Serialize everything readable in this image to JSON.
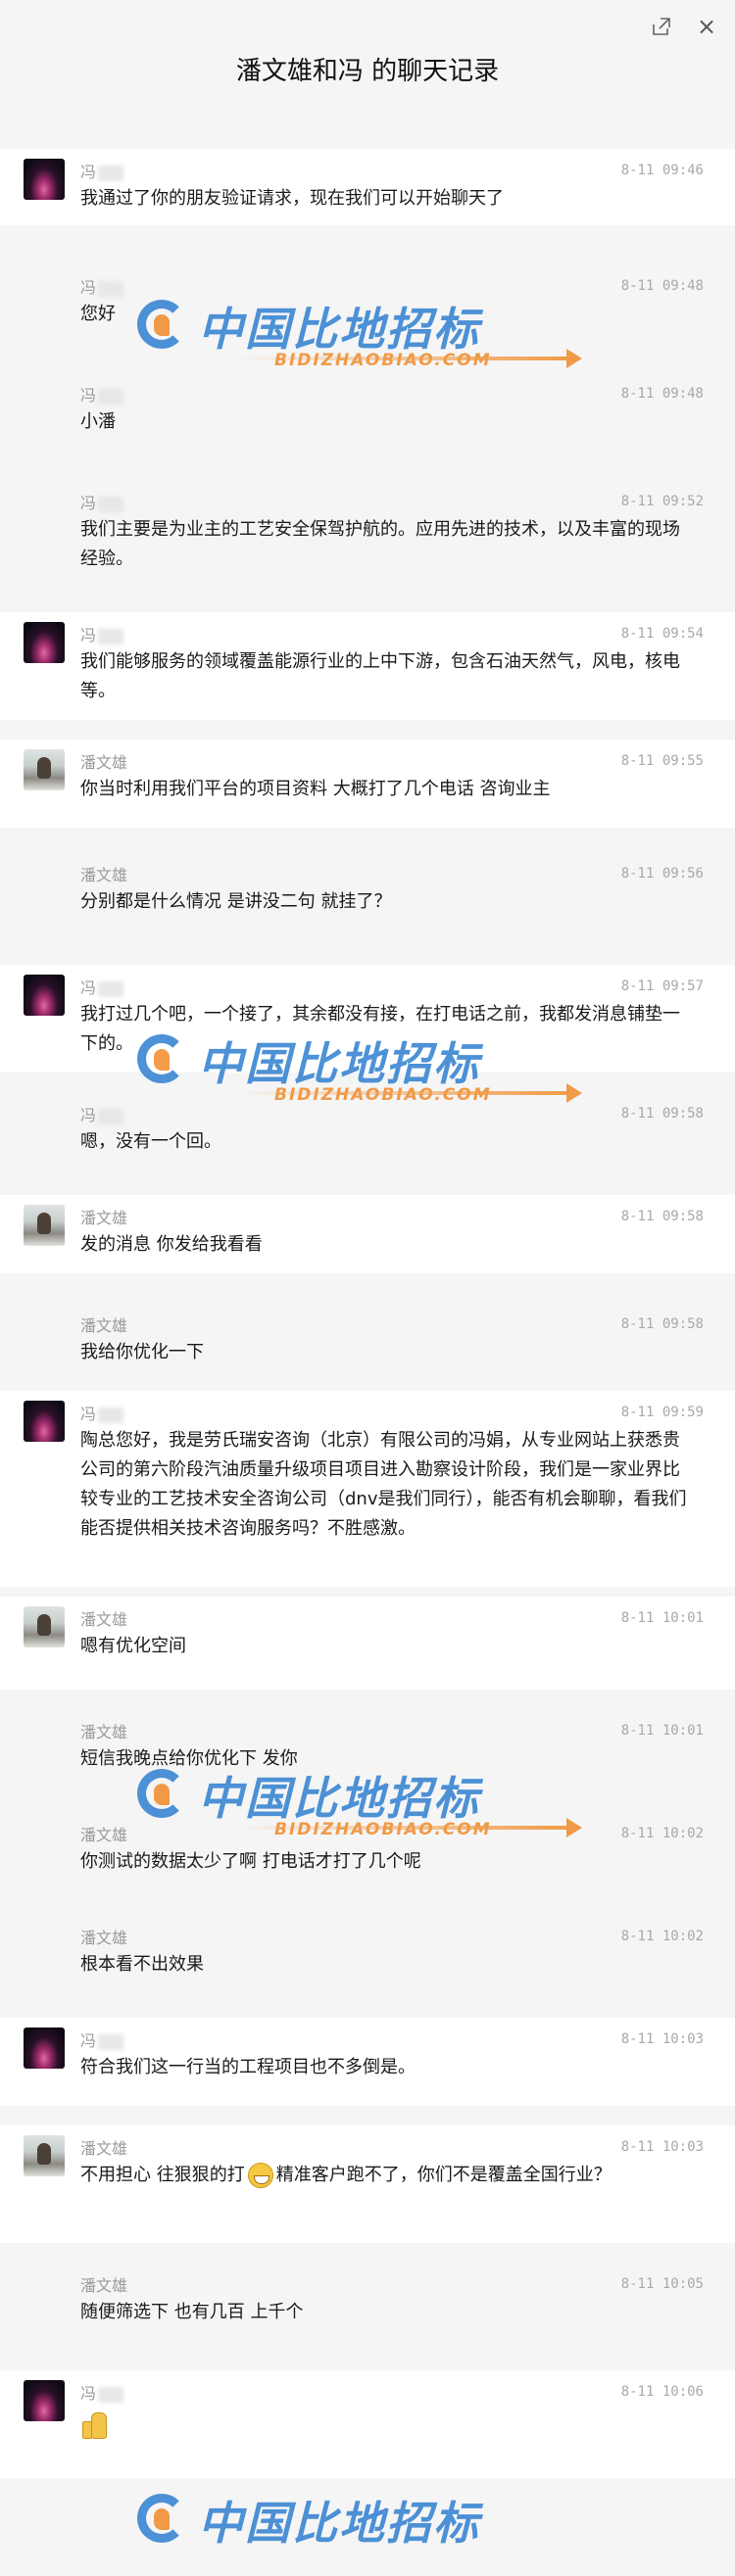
{
  "window": {
    "title": "潘文雄和冯 的聊天记录",
    "popout_icon": "popout-icon",
    "close_icon": "close-icon",
    "close_glyph": "×"
  },
  "watermark": {
    "cn": "中国比地招标",
    "en": "BIDIZHAOBIAO.COM",
    "colors": {
      "blue": "#2f7fd0",
      "orange": "#f08b2a"
    }
  },
  "messages": [
    {
      "sender": "冯",
      "time": "8-11 09:46",
      "text": "我通过了你的朋友验证请求，现在我们可以开始聊天了"
    },
    {
      "sender": "冯",
      "time": "8-11 09:48",
      "text": "您好"
    },
    {
      "sender": "冯",
      "time": "8-11 09:48",
      "text": "小潘"
    },
    {
      "sender": "冯",
      "time": "8-11 09:52",
      "text": "我们主要是为业主的工艺安全保驾护航的。应用先进的技术，以及丰富的现场经验。"
    },
    {
      "sender": "冯",
      "time": "8-11 09:54",
      "text": "我们能够服务的领域覆盖能源行业的上中下游，包含石油天然气，风电，核电等。"
    },
    {
      "sender": "潘文雄",
      "time": "8-11 09:55",
      "text": "你当时利用我们平台的项目资料 大概打了几个电话 咨询业主"
    },
    {
      "sender": "潘文雄",
      "time": "8-11 09:56",
      "text": "分别都是什么情况 是讲没二句 就挂了？"
    },
    {
      "sender": "冯",
      "time": "8-11 09:57",
      "text": "我打过几个吧，一个接了，其余都没有接，在打电话之前，我都发消息铺垫一下的。"
    },
    {
      "sender": "冯",
      "time": "8-11 09:58",
      "text": "嗯，没有一个回。"
    },
    {
      "sender": "潘文雄",
      "time": "8-11 09:58",
      "text": "发的消息 你发给我看看"
    },
    {
      "sender": "潘文雄",
      "time": "8-11 09:58",
      "text": "我给你优化一下"
    },
    {
      "sender": "冯",
      "time": "8-11 09:59",
      "text": "陶总您好，我是劳氏瑞安咨询（北京）有限公司的冯娟，从专业网站上获悉贵公司的第六阶段汽油质量升级项目项目进入勘察设计阶段，我们是一家业界比较专业的工艺技术安全咨询公司（dnv是我们同行），能否有机会聊聊，看我们能否提供相关技术咨询服务吗？不胜感激。"
    },
    {
      "sender": "潘文雄",
      "time": "8-11 10:01",
      "text": "嗯有优化空间"
    },
    {
      "sender": "潘文雄",
      "time": "8-11 10:01",
      "text": "短信我晚点给你优化下 发你"
    },
    {
      "sender": "潘文雄",
      "time": "8-11 10:02",
      "text": "你测试的数据太少了啊 打电话才打了几个呢"
    },
    {
      "sender": "潘文雄",
      "time": "8-11 10:02",
      "text": "根本看不出效果"
    },
    {
      "sender": "冯",
      "time": "8-11 10:03",
      "text": "符合我们这一行当的工程项目也不多倒是。"
    },
    {
      "sender": "潘文雄",
      "time": "8-11 10:03",
      "text_before": "不用担心 往狠狠的打",
      "emoji": "grin-emoji",
      "text_after": "精准客户跑不了，你们不是覆盖全国行业？"
    },
    {
      "sender": "潘文雄",
      "time": "8-11 10:05",
      "text": "随便筛选下 也有几百 上千个"
    },
    {
      "sender": "冯",
      "time": "8-11 10:06",
      "emoji": "thumbs-up-emoji"
    }
  ]
}
